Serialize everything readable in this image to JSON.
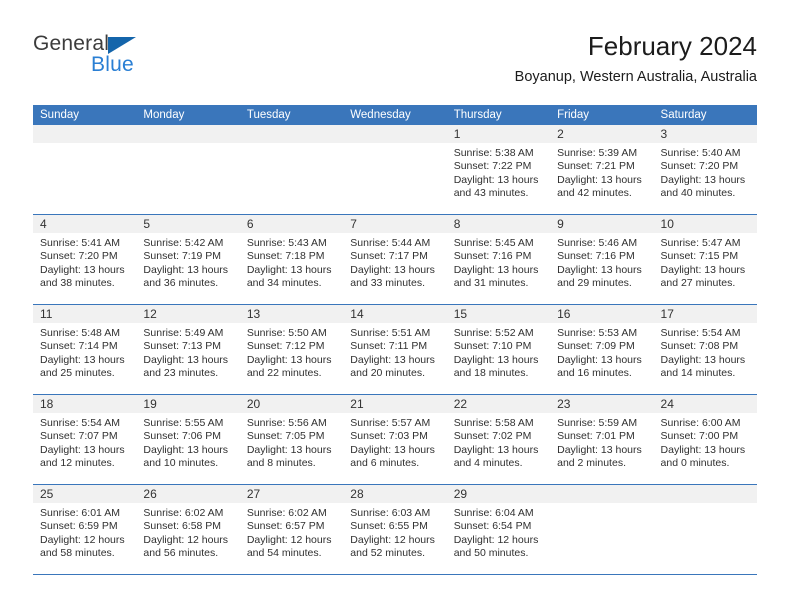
{
  "brand": {
    "name_part1": "General",
    "name_part2": "Blue"
  },
  "header": {
    "title": "February 2024",
    "subtitle": "Boyanup, Western Australia, Australia"
  },
  "colors": {
    "header_blue": "#3a76bb",
    "brand_blue": "#2a7fd4",
    "brand_triangle": "#1465ab",
    "daynum_band": "#f1f1f1",
    "text": "#303030"
  },
  "weekdays": [
    "Sunday",
    "Monday",
    "Tuesday",
    "Wednesday",
    "Thursday",
    "Friday",
    "Saturday"
  ],
  "weeks": [
    [
      {
        "day": "",
        "sunrise": "",
        "sunset": "",
        "daylight": "",
        "empty": true
      },
      {
        "day": "",
        "sunrise": "",
        "sunset": "",
        "daylight": "",
        "empty": true
      },
      {
        "day": "",
        "sunrise": "",
        "sunset": "",
        "daylight": "",
        "empty": true
      },
      {
        "day": "",
        "sunrise": "",
        "sunset": "",
        "daylight": "",
        "empty": true
      },
      {
        "day": "1",
        "sunrise": "Sunrise: 5:38 AM",
        "sunset": "Sunset: 7:22 PM",
        "daylight": "Daylight: 13 hours and 43 minutes.",
        "empty": false
      },
      {
        "day": "2",
        "sunrise": "Sunrise: 5:39 AM",
        "sunset": "Sunset: 7:21 PM",
        "daylight": "Daylight: 13 hours and 42 minutes.",
        "empty": false
      },
      {
        "day": "3",
        "sunrise": "Sunrise: 5:40 AM",
        "sunset": "Sunset: 7:20 PM",
        "daylight": "Daylight: 13 hours and 40 minutes.",
        "empty": false
      }
    ],
    [
      {
        "day": "4",
        "sunrise": "Sunrise: 5:41 AM",
        "sunset": "Sunset: 7:20 PM",
        "daylight": "Daylight: 13 hours and 38 minutes.",
        "empty": false
      },
      {
        "day": "5",
        "sunrise": "Sunrise: 5:42 AM",
        "sunset": "Sunset: 7:19 PM",
        "daylight": "Daylight: 13 hours and 36 minutes.",
        "empty": false
      },
      {
        "day": "6",
        "sunrise": "Sunrise: 5:43 AM",
        "sunset": "Sunset: 7:18 PM",
        "daylight": "Daylight: 13 hours and 34 minutes.",
        "empty": false
      },
      {
        "day": "7",
        "sunrise": "Sunrise: 5:44 AM",
        "sunset": "Sunset: 7:17 PM",
        "daylight": "Daylight: 13 hours and 33 minutes.",
        "empty": false
      },
      {
        "day": "8",
        "sunrise": "Sunrise: 5:45 AM",
        "sunset": "Sunset: 7:16 PM",
        "daylight": "Daylight: 13 hours and 31 minutes.",
        "empty": false
      },
      {
        "day": "9",
        "sunrise": "Sunrise: 5:46 AM",
        "sunset": "Sunset: 7:16 PM",
        "daylight": "Daylight: 13 hours and 29 minutes.",
        "empty": false
      },
      {
        "day": "10",
        "sunrise": "Sunrise: 5:47 AM",
        "sunset": "Sunset: 7:15 PM",
        "daylight": "Daylight: 13 hours and 27 minutes.",
        "empty": false
      }
    ],
    [
      {
        "day": "11",
        "sunrise": "Sunrise: 5:48 AM",
        "sunset": "Sunset: 7:14 PM",
        "daylight": "Daylight: 13 hours and 25 minutes.",
        "empty": false
      },
      {
        "day": "12",
        "sunrise": "Sunrise: 5:49 AM",
        "sunset": "Sunset: 7:13 PM",
        "daylight": "Daylight: 13 hours and 23 minutes.",
        "empty": false
      },
      {
        "day": "13",
        "sunrise": "Sunrise: 5:50 AM",
        "sunset": "Sunset: 7:12 PM",
        "daylight": "Daylight: 13 hours and 22 minutes.",
        "empty": false
      },
      {
        "day": "14",
        "sunrise": "Sunrise: 5:51 AM",
        "sunset": "Sunset: 7:11 PM",
        "daylight": "Daylight: 13 hours and 20 minutes.",
        "empty": false
      },
      {
        "day": "15",
        "sunrise": "Sunrise: 5:52 AM",
        "sunset": "Sunset: 7:10 PM",
        "daylight": "Daylight: 13 hours and 18 minutes.",
        "empty": false
      },
      {
        "day": "16",
        "sunrise": "Sunrise: 5:53 AM",
        "sunset": "Sunset: 7:09 PM",
        "daylight": "Daylight: 13 hours and 16 minutes.",
        "empty": false
      },
      {
        "day": "17",
        "sunrise": "Sunrise: 5:54 AM",
        "sunset": "Sunset: 7:08 PM",
        "daylight": "Daylight: 13 hours and 14 minutes.",
        "empty": false
      }
    ],
    [
      {
        "day": "18",
        "sunrise": "Sunrise: 5:54 AM",
        "sunset": "Sunset: 7:07 PM",
        "daylight": "Daylight: 13 hours and 12 minutes.",
        "empty": false
      },
      {
        "day": "19",
        "sunrise": "Sunrise: 5:55 AM",
        "sunset": "Sunset: 7:06 PM",
        "daylight": "Daylight: 13 hours and 10 minutes.",
        "empty": false
      },
      {
        "day": "20",
        "sunrise": "Sunrise: 5:56 AM",
        "sunset": "Sunset: 7:05 PM",
        "daylight": "Daylight: 13 hours and 8 minutes.",
        "empty": false
      },
      {
        "day": "21",
        "sunrise": "Sunrise: 5:57 AM",
        "sunset": "Sunset: 7:03 PM",
        "daylight": "Daylight: 13 hours and 6 minutes.",
        "empty": false
      },
      {
        "day": "22",
        "sunrise": "Sunrise: 5:58 AM",
        "sunset": "Sunset: 7:02 PM",
        "daylight": "Daylight: 13 hours and 4 minutes.",
        "empty": false
      },
      {
        "day": "23",
        "sunrise": "Sunrise: 5:59 AM",
        "sunset": "Sunset: 7:01 PM",
        "daylight": "Daylight: 13 hours and 2 minutes.",
        "empty": false
      },
      {
        "day": "24",
        "sunrise": "Sunrise: 6:00 AM",
        "sunset": "Sunset: 7:00 PM",
        "daylight": "Daylight: 13 hours and 0 minutes.",
        "empty": false
      }
    ],
    [
      {
        "day": "25",
        "sunrise": "Sunrise: 6:01 AM",
        "sunset": "Sunset: 6:59 PM",
        "daylight": "Daylight: 12 hours and 58 minutes.",
        "empty": false
      },
      {
        "day": "26",
        "sunrise": "Sunrise: 6:02 AM",
        "sunset": "Sunset: 6:58 PM",
        "daylight": "Daylight: 12 hours and 56 minutes.",
        "empty": false
      },
      {
        "day": "27",
        "sunrise": "Sunrise: 6:02 AM",
        "sunset": "Sunset: 6:57 PM",
        "daylight": "Daylight: 12 hours and 54 minutes.",
        "empty": false
      },
      {
        "day": "28",
        "sunrise": "Sunrise: 6:03 AM",
        "sunset": "Sunset: 6:55 PM",
        "daylight": "Daylight: 12 hours and 52 minutes.",
        "empty": false
      },
      {
        "day": "29",
        "sunrise": "Sunrise: 6:04 AM",
        "sunset": "Sunset: 6:54 PM",
        "daylight": "Daylight: 12 hours and 50 minutes.",
        "empty": false
      },
      {
        "day": "",
        "sunrise": "",
        "sunset": "",
        "daylight": "",
        "empty": true
      },
      {
        "day": "",
        "sunrise": "",
        "sunset": "",
        "daylight": "",
        "empty": true
      }
    ]
  ]
}
